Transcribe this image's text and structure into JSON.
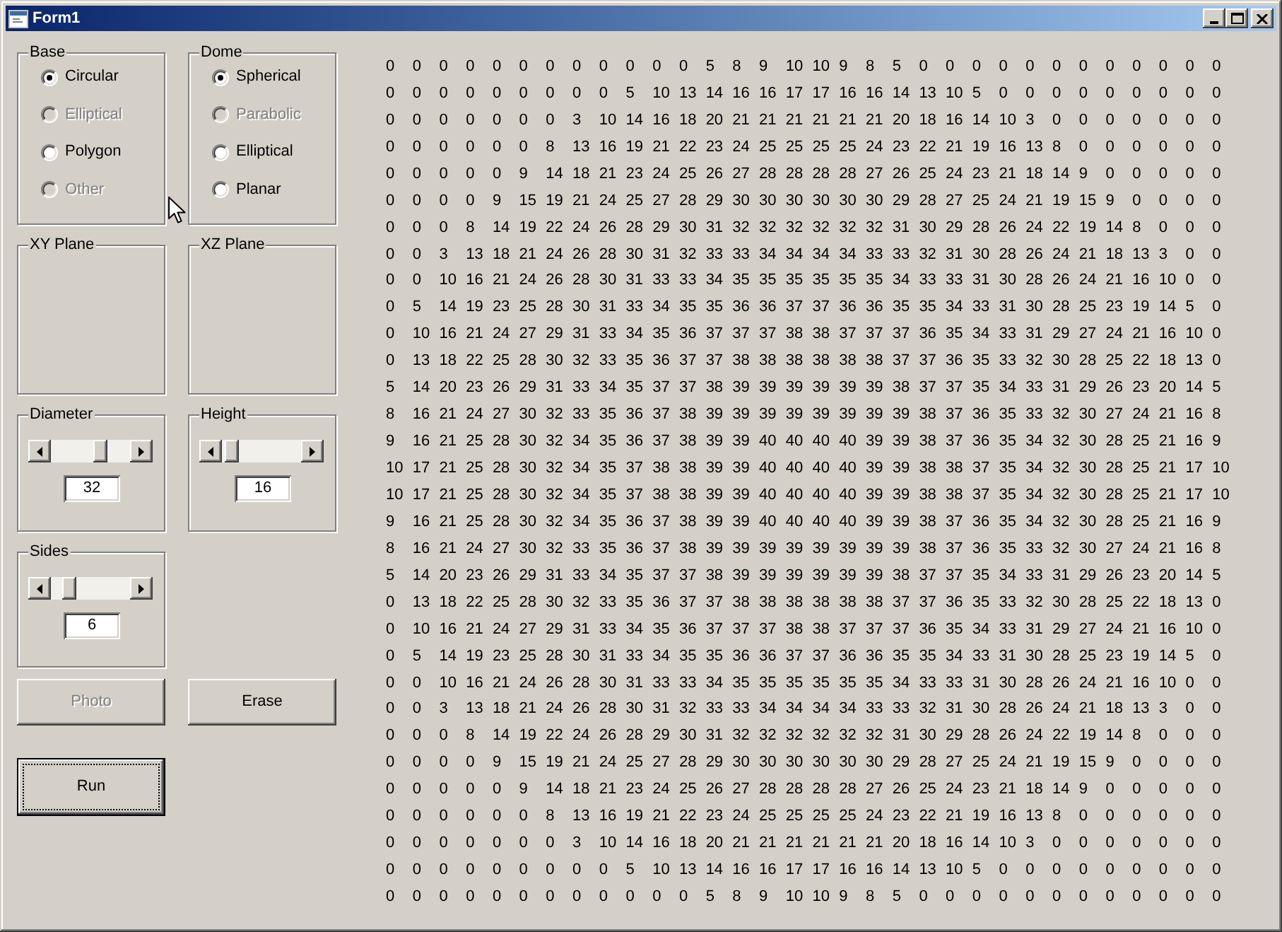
{
  "window": {
    "title": "Form1"
  },
  "base": {
    "label": "Base",
    "options": [
      {
        "label": "Circular",
        "selected": true,
        "disabled": false
      },
      {
        "label": "Elliptical",
        "selected": false,
        "disabled": true
      },
      {
        "label": "Polygon",
        "selected": false,
        "disabled": false
      },
      {
        "label": "Other",
        "selected": false,
        "disabled": true
      }
    ]
  },
  "dome": {
    "label": "Dome",
    "options": [
      {
        "label": "Spherical",
        "selected": true,
        "disabled": false
      },
      {
        "label": "Parabolic",
        "selected": false,
        "disabled": true
      },
      {
        "label": "Elliptical",
        "selected": false,
        "disabled": false
      },
      {
        "label": "Planar",
        "selected": false,
        "disabled": false
      }
    ]
  },
  "planes": [
    {
      "label": "XY Plane"
    },
    {
      "label": "XZ Plane"
    }
  ],
  "scrollers": [
    {
      "label": "Diameter",
      "level": 0.65,
      "value": "32"
    },
    {
      "label": "Height",
      "level": 0.04,
      "value": "16"
    },
    {
      "label": "Sides",
      "level": 0.17,
      "value": "6"
    }
  ],
  "buttons": [
    {
      "label": "Photo",
      "disabled": true,
      "default": false
    },
    {
      "label": "Erase",
      "disabled": false,
      "default": false
    },
    {
      "label": "Run",
      "disabled": false,
      "default": true
    }
  ],
  "output_grid": {
    "rows": [
      [
        "0",
        "0",
        "0",
        "0",
        "0",
        "0",
        "0",
        "0",
        "0",
        "0",
        "0",
        "0",
        "5",
        "8",
        "9",
        "10",
        "10",
        "9",
        "8",
        "5",
        "0",
        "0",
        "0",
        "0",
        "0",
        "0",
        "0",
        "0",
        "0",
        "0",
        "0",
        "0"
      ],
      [
        "0",
        "0",
        "0",
        "0",
        "0",
        "0",
        "0",
        "0",
        "0",
        "5",
        "10",
        "13",
        "14",
        "16",
        "16",
        "17",
        "17",
        "16",
        "16",
        "14",
        "13",
        "10",
        "5",
        "0",
        "0",
        "0",
        "0",
        "0",
        "0",
        "0",
        "0",
        "0"
      ],
      [
        "0",
        "0",
        "0",
        "0",
        "0",
        "0",
        "0",
        "3",
        "10",
        "14",
        "16",
        "18",
        "20",
        "21",
        "21",
        "21",
        "21",
        "21",
        "21",
        "20",
        "18",
        "16",
        "14",
        "10",
        "3",
        "0",
        "0",
        "0",
        "0",
        "0",
        "0",
        "0"
      ],
      [
        "0",
        "0",
        "0",
        "0",
        "0",
        "0",
        "8",
        "13",
        "16",
        "19",
        "21",
        "22",
        "23",
        "24",
        "25",
        "25",
        "25",
        "25",
        "24",
        "23",
        "22",
        "21",
        "19",
        "16",
        "13",
        "8",
        "0",
        "0",
        "0",
        "0",
        "0",
        "0"
      ],
      [
        "0",
        "0",
        "0",
        "0",
        "0",
        "9",
        "14",
        "18",
        "21",
        "23",
        "24",
        "25",
        "26",
        "27",
        "28",
        "28",
        "28",
        "28",
        "27",
        "26",
        "25",
        "24",
        "23",
        "21",
        "18",
        "14",
        "9",
        "0",
        "0",
        "0",
        "0",
        "0"
      ],
      [
        "0",
        "0",
        "0",
        "0",
        "9",
        "15",
        "19",
        "21",
        "24",
        "25",
        "27",
        "28",
        "29",
        "30",
        "30",
        "30",
        "30",
        "30",
        "30",
        "29",
        "28",
        "27",
        "25",
        "24",
        "21",
        "19",
        "15",
        "9",
        "0",
        "0",
        "0",
        "0"
      ],
      [
        "0",
        "0",
        "0",
        "8",
        "14",
        "19",
        "22",
        "24",
        "26",
        "28",
        "29",
        "30",
        "31",
        "32",
        "32",
        "32",
        "32",
        "32",
        "32",
        "31",
        "30",
        "29",
        "28",
        "26",
        "24",
        "22",
        "19",
        "14",
        "8",
        "0",
        "0",
        "0"
      ],
      [
        "0",
        "0",
        "3",
        "13",
        "18",
        "21",
        "24",
        "26",
        "28",
        "30",
        "31",
        "32",
        "33",
        "33",
        "34",
        "34",
        "34",
        "34",
        "33",
        "33",
        "32",
        "31",
        "30",
        "28",
        "26",
        "24",
        "21",
        "18",
        "13",
        "3",
        "0",
        "0"
      ],
      [
        "0",
        "0",
        "10",
        "16",
        "21",
        "24",
        "26",
        "28",
        "30",
        "31",
        "33",
        "33",
        "34",
        "35",
        "35",
        "35",
        "35",
        "35",
        "35",
        "34",
        "33",
        "33",
        "31",
        "30",
        "28",
        "26",
        "24",
        "21",
        "16",
        "10",
        "0",
        "0"
      ],
      [
        "0",
        "5",
        "14",
        "19",
        "23",
        "25",
        "28",
        "30",
        "31",
        "33",
        "34",
        "35",
        "35",
        "36",
        "36",
        "37",
        "37",
        "36",
        "36",
        "35",
        "35",
        "34",
        "33",
        "31",
        "30",
        "28",
        "25",
        "23",
        "19",
        "14",
        "5",
        "0"
      ],
      [
        "0",
        "10",
        "16",
        "21",
        "24",
        "27",
        "29",
        "31",
        "33",
        "34",
        "35",
        "36",
        "37",
        "37",
        "37",
        "38",
        "38",
        "37",
        "37",
        "37",
        "36",
        "35",
        "34",
        "33",
        "31",
        "29",
        "27",
        "24",
        "21",
        "16",
        "10",
        "0"
      ],
      [
        "0",
        "13",
        "18",
        "22",
        "25",
        "28",
        "30",
        "32",
        "33",
        "35",
        "36",
        "37",
        "37",
        "38",
        "38",
        "38",
        "38",
        "38",
        "38",
        "37",
        "37",
        "36",
        "35",
        "33",
        "32",
        "30",
        "28",
        "25",
        "22",
        "18",
        "13",
        "0"
      ],
      [
        "5",
        "14",
        "20",
        "23",
        "26",
        "29",
        "31",
        "33",
        "34",
        "35",
        "37",
        "37",
        "38",
        "39",
        "39",
        "39",
        "39",
        "39",
        "39",
        "38",
        "37",
        "37",
        "35",
        "34",
        "33",
        "31",
        "29",
        "26",
        "23",
        "20",
        "14",
        "5"
      ],
      [
        "8",
        "16",
        "21",
        "24",
        "27",
        "30",
        "32",
        "33",
        "35",
        "36",
        "37",
        "38",
        "39",
        "39",
        "39",
        "39",
        "39",
        "39",
        "39",
        "39",
        "38",
        "37",
        "36",
        "35",
        "33",
        "32",
        "30",
        "27",
        "24",
        "21",
        "16",
        "8"
      ],
      [
        "9",
        "16",
        "21",
        "25",
        "28",
        "30",
        "32",
        "34",
        "35",
        "36",
        "37",
        "38",
        "39",
        "39",
        "40",
        "40",
        "40",
        "40",
        "39",
        "39",
        "38",
        "37",
        "36",
        "35",
        "34",
        "32",
        "30",
        "28",
        "25",
        "21",
        "16",
        "9"
      ],
      [
        "10",
        "17",
        "21",
        "25",
        "28",
        "30",
        "32",
        "34",
        "35",
        "37",
        "38",
        "38",
        "39",
        "39",
        "40",
        "40",
        "40",
        "40",
        "39",
        "39",
        "38",
        "38",
        "37",
        "35",
        "34",
        "32",
        "30",
        "28",
        "25",
        "21",
        "17",
        "10"
      ],
      [
        "10",
        "17",
        "21",
        "25",
        "28",
        "30",
        "32",
        "34",
        "35",
        "37",
        "38",
        "38",
        "39",
        "39",
        "40",
        "40",
        "40",
        "40",
        "39",
        "39",
        "38",
        "38",
        "37",
        "35",
        "34",
        "32",
        "30",
        "28",
        "25",
        "21",
        "17",
        "10"
      ],
      [
        "9",
        "16",
        "21",
        "25",
        "28",
        "30",
        "32",
        "34",
        "35",
        "36",
        "37",
        "38",
        "39",
        "39",
        "40",
        "40",
        "40",
        "40",
        "39",
        "39",
        "38",
        "37",
        "36",
        "35",
        "34",
        "32",
        "30",
        "28",
        "25",
        "21",
        "16",
        "9"
      ],
      [
        "8",
        "16",
        "21",
        "24",
        "27",
        "30",
        "32",
        "33",
        "35",
        "36",
        "37",
        "38",
        "39",
        "39",
        "39",
        "39",
        "39",
        "39",
        "39",
        "39",
        "38",
        "37",
        "36",
        "35",
        "33",
        "32",
        "30",
        "27",
        "24",
        "21",
        "16",
        "8"
      ],
      [
        "5",
        "14",
        "20",
        "23",
        "26",
        "29",
        "31",
        "33",
        "34",
        "35",
        "37",
        "37",
        "38",
        "39",
        "39",
        "39",
        "39",
        "39",
        "39",
        "38",
        "37",
        "37",
        "35",
        "34",
        "33",
        "31",
        "29",
        "26",
        "23",
        "20",
        "14",
        "5"
      ],
      [
        "0",
        "13",
        "18",
        "22",
        "25",
        "28",
        "30",
        "32",
        "33",
        "35",
        "36",
        "37",
        "37",
        "38",
        "38",
        "38",
        "38",
        "38",
        "38",
        "37",
        "37",
        "36",
        "35",
        "33",
        "32",
        "30",
        "28",
        "25",
        "22",
        "18",
        "13",
        "0"
      ],
      [
        "0",
        "10",
        "16",
        "21",
        "24",
        "27",
        "29",
        "31",
        "33",
        "34",
        "35",
        "36",
        "37",
        "37",
        "37",
        "38",
        "38",
        "37",
        "37",
        "37",
        "36",
        "35",
        "34",
        "33",
        "31",
        "29",
        "27",
        "24",
        "21",
        "16",
        "10",
        "0"
      ],
      [
        "0",
        "5",
        "14",
        "19",
        "23",
        "25",
        "28",
        "30",
        "31",
        "33",
        "34",
        "35",
        "35",
        "36",
        "36",
        "37",
        "37",
        "36",
        "36",
        "35",
        "35",
        "34",
        "33",
        "31",
        "30",
        "28",
        "25",
        "23",
        "19",
        "14",
        "5",
        "0"
      ],
      [
        "0",
        "0",
        "10",
        "16",
        "21",
        "24",
        "26",
        "28",
        "30",
        "31",
        "33",
        "33",
        "34",
        "35",
        "35",
        "35",
        "35",
        "35",
        "35",
        "34",
        "33",
        "33",
        "31",
        "30",
        "28",
        "26",
        "24",
        "21",
        "16",
        "10",
        "0",
        "0"
      ],
      [
        "0",
        "0",
        "3",
        "13",
        "18",
        "21",
        "24",
        "26",
        "28",
        "30",
        "31",
        "32",
        "33",
        "33",
        "34",
        "34",
        "34",
        "34",
        "33",
        "33",
        "32",
        "31",
        "30",
        "28",
        "26",
        "24",
        "21",
        "18",
        "13",
        "3",
        "0",
        "0"
      ],
      [
        "0",
        "0",
        "0",
        "8",
        "14",
        "19",
        "22",
        "24",
        "26",
        "28",
        "29",
        "30",
        "31",
        "32",
        "32",
        "32",
        "32",
        "32",
        "32",
        "31",
        "30",
        "29",
        "28",
        "26",
        "24",
        "22",
        "19",
        "14",
        "8",
        "0",
        "0",
        "0"
      ],
      [
        "0",
        "0",
        "0",
        "0",
        "9",
        "15",
        "19",
        "21",
        "24",
        "25",
        "27",
        "28",
        "29",
        "30",
        "30",
        "30",
        "30",
        "30",
        "30",
        "29",
        "28",
        "27",
        "25",
        "24",
        "21",
        "19",
        "15",
        "9",
        "0",
        "0",
        "0",
        "0"
      ],
      [
        "0",
        "0",
        "0",
        "0",
        "0",
        "9",
        "14",
        "18",
        "21",
        "23",
        "24",
        "25",
        "26",
        "27",
        "28",
        "28",
        "28",
        "28",
        "27",
        "26",
        "25",
        "24",
        "23",
        "21",
        "18",
        "14",
        "9",
        "0",
        "0",
        "0",
        "0",
        "0"
      ],
      [
        "0",
        "0",
        "0",
        "0",
        "0",
        "0",
        "8",
        "13",
        "16",
        "19",
        "21",
        "22",
        "23",
        "24",
        "25",
        "25",
        "25",
        "25",
        "24",
        "23",
        "22",
        "21",
        "19",
        "16",
        "13",
        "8",
        "0",
        "0",
        "0",
        "0",
        "0",
        "0"
      ],
      [
        "0",
        "0",
        "0",
        "0",
        "0",
        "0",
        "0",
        "3",
        "10",
        "14",
        "16",
        "18",
        "20",
        "21",
        "21",
        "21",
        "21",
        "21",
        "21",
        "20",
        "18",
        "16",
        "14",
        "10",
        "3",
        "0",
        "0",
        "0",
        "0",
        "0",
        "0",
        "0"
      ],
      [
        "0",
        "0",
        "0",
        "0",
        "0",
        "0",
        "0",
        "0",
        "0",
        "5",
        "10",
        "13",
        "14",
        "16",
        "16",
        "17",
        "17",
        "16",
        "16",
        "14",
        "13",
        "10",
        "5",
        "0",
        "0",
        "0",
        "0",
        "0",
        "0",
        "0",
        "0",
        "0"
      ],
      [
        "0",
        "0",
        "0",
        "0",
        "0",
        "0",
        "0",
        "0",
        "0",
        "0",
        "0",
        "0",
        "5",
        "8",
        "9",
        "10",
        "10",
        "9",
        "8",
        "5",
        "0",
        "0",
        "0",
        "0",
        "0",
        "0",
        "0",
        "0",
        "0",
        "0",
        "0",
        "0"
      ]
    ]
  }
}
